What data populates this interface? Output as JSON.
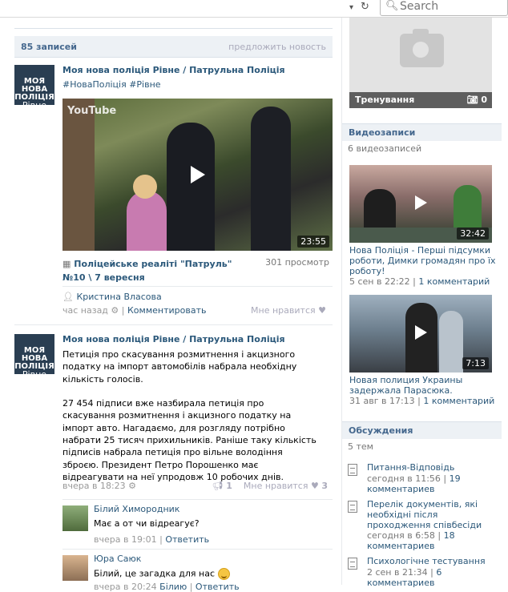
{
  "browser": {
    "search_placeholder": "Search"
  },
  "wall": {
    "count": "85 записей",
    "suggest": "предложить новость"
  },
  "group": {
    "avatar_line1": "МОЯ НОВА",
    "avatar_line2": "ПОЛІЦІЯ",
    "avatar_line3": "Рівне"
  },
  "post1": {
    "author": "Моя нова поліція Рівне / Патрульна Поліція",
    "tags": "#НоваПоліція #Рівне",
    "video_watermark": "YouTube",
    "duration": "23:55",
    "video_title": "Поліцейське реаліті \"Патруль\" №10 \\ 7 вересня",
    "views": "301 просмотр",
    "person": "Кристина Власова",
    "time": "час назад",
    "comment_link": "Комментировать",
    "like": "Мне нравится"
  },
  "post2": {
    "author": "Моя нова поліція Рівне / Патрульна Поліція",
    "text": "Петиція про скасування розмитнення і акцизного податку на імпорт автомобілів набрала необхідну кількість голосів.\n\n27 454 підписи вже назбирала петиція про скасування розмитнення і акцизного податку на імпорт авто. Нагадаємо, для розгляду потрібно набрати 25 тисяч прихильників. Раніше таку кількість підписів набрала петиція про вільне володіння зброєю. Президент Петро Порошенко має відреагувати на неї упродовж 10 робочих днів.",
    "time": "вчера в 18:23",
    "shares": "1",
    "like": "Мне нравится",
    "likes": "3"
  },
  "comments": [
    {
      "name": "Білий Химородник",
      "text": "Має а от чи відреагує?",
      "time": "вчера в 19:01",
      "action": "Ответить"
    },
    {
      "name": "Юра Саюк",
      "text": "Білий, це загадка для нас",
      "time": "вчера в 20:24",
      "reply_to": "Білию",
      "action": "Ответить"
    }
  ],
  "sidebar": {
    "album": {
      "title": "Тренування",
      "count": "0"
    },
    "videos": {
      "header": "Видеозаписи",
      "count": "6 видеозаписей",
      "items": [
        {
          "duration": "32:42",
          "title": "Нова Поліція - Перші підсумки роботи, Димки громадян про їх роботу!",
          "date": "5 сен в 22:22",
          "comments": "1 комментарий"
        },
        {
          "duration": "7:13",
          "title": "Новая полиция Украины задержала Парасюка.",
          "date": "31 авг в 17:13",
          "comments": "1 комментарий"
        }
      ]
    },
    "discussions": {
      "header": "Обсуждения",
      "count": "5 тем",
      "items": [
        {
          "title": "Питання-Відповідь",
          "time": "сегодня в 11:56",
          "comments": "19 комментариев"
        },
        {
          "title": "Перелік документів, які необхідні після проходження співбесіди",
          "time": "сегодня в 6:58",
          "comments": "18 комментариев"
        },
        {
          "title": "Психологічне тестування",
          "time": "2 сен в 21:34",
          "comments": "6 комментариев"
        }
      ]
    }
  }
}
